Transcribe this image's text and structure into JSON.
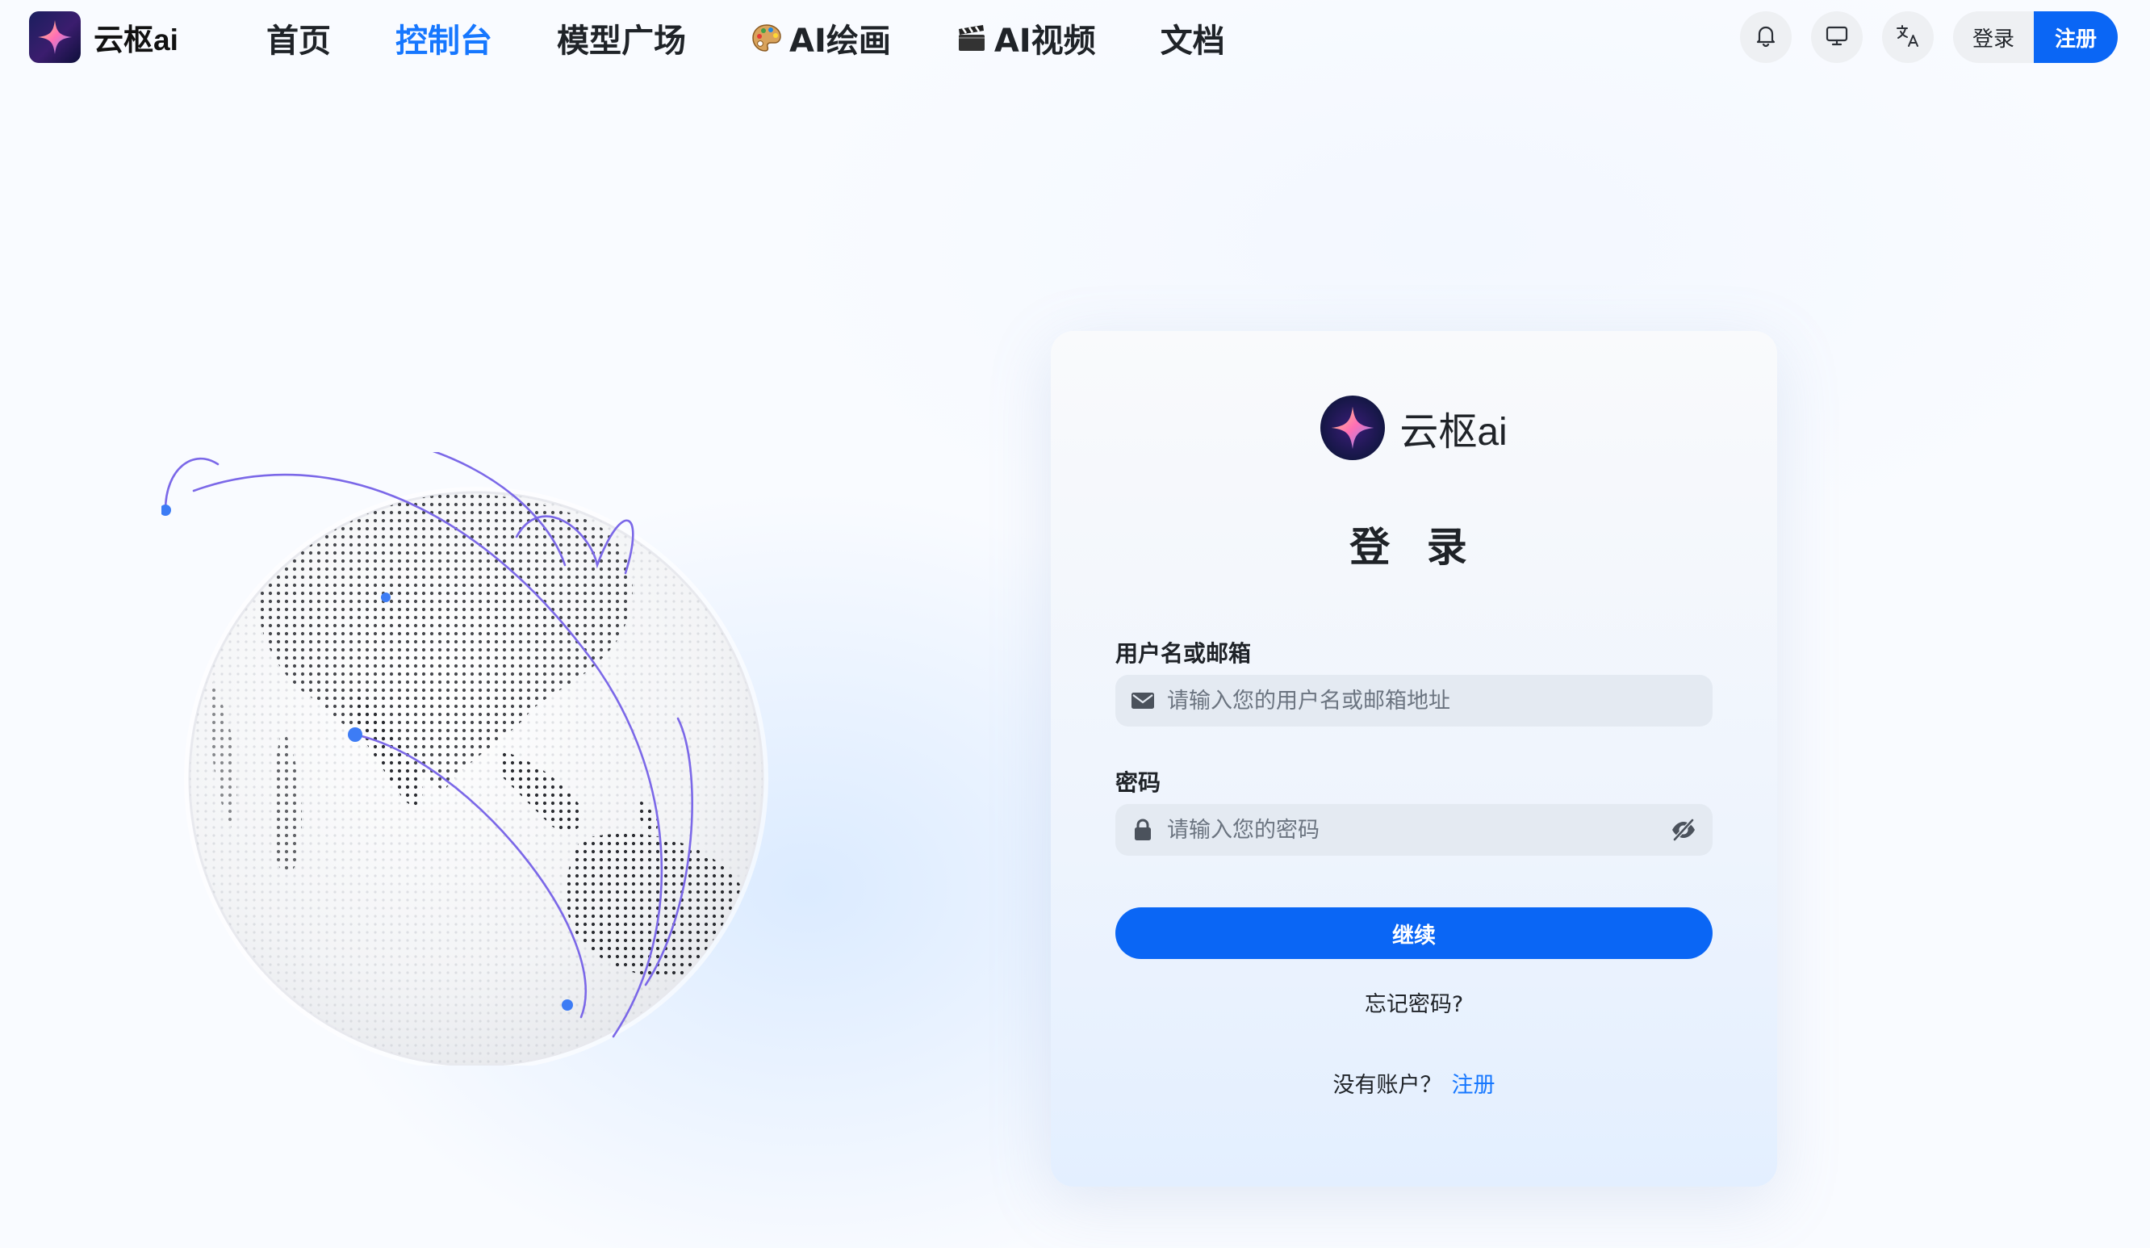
{
  "brand": {
    "name": "云枢ai"
  },
  "nav": {
    "items": [
      {
        "label": "首页",
        "active": false
      },
      {
        "label": "控制台",
        "active": true
      },
      {
        "label": "模型广场",
        "active": false
      },
      {
        "label": "AI绘画",
        "active": false,
        "icon": "palette-icon"
      },
      {
        "label": "AI视频",
        "active": false,
        "icon": "clapperboard-icon"
      },
      {
        "label": "文档",
        "active": false
      }
    ]
  },
  "header": {
    "icons": [
      "bell-icon",
      "monitor-icon",
      "translate-icon"
    ],
    "login_label": "登录",
    "register_label": "注册"
  },
  "login": {
    "brand_name": "云枢ai",
    "title": "登 录",
    "username": {
      "label": "用户名或邮箱",
      "placeholder": "请输入您的用户名或邮箱地址",
      "value": ""
    },
    "password": {
      "label": "密码",
      "placeholder": "请输入您的密码",
      "value": ""
    },
    "continue_label": "继续",
    "forgot_label": "忘记密码?",
    "no_account_text": "没有账户？",
    "register_link": "注册"
  },
  "colors": {
    "accent": "#0a66f5",
    "nav_active": "#1677ff",
    "field_bg": "#e4eaf2",
    "arc": "#7b68e8",
    "arc_dot": "#3d7cf5"
  }
}
